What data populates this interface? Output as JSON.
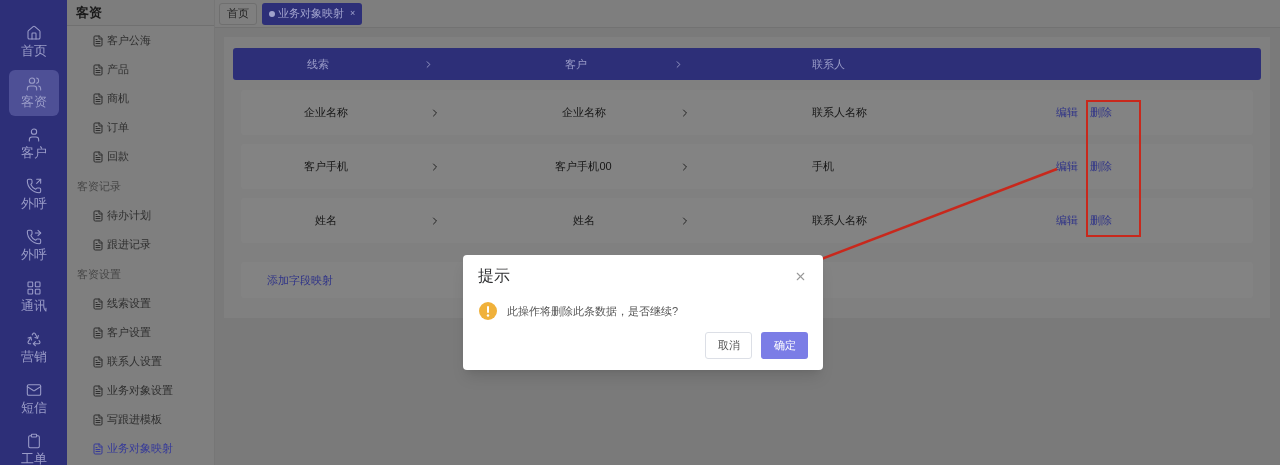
{
  "icon_bar": {
    "items": [
      {
        "label": "首页",
        "selected": false
      },
      {
        "label": "客资",
        "selected": true
      },
      {
        "label": "客户",
        "selected": false
      },
      {
        "label": "外呼",
        "selected": false
      },
      {
        "label": "外呼",
        "selected": false
      },
      {
        "label": "通讯",
        "selected": false
      },
      {
        "label": "营销",
        "selected": false
      },
      {
        "label": "短信",
        "selected": false
      },
      {
        "label": "工单",
        "selected": false
      }
    ]
  },
  "nav": {
    "title": "客资",
    "entries": [
      {
        "kind": "item",
        "label": "客户公海",
        "selected": false
      },
      {
        "kind": "item",
        "label": "产品",
        "selected": false
      },
      {
        "kind": "item",
        "label": "商机",
        "selected": false
      },
      {
        "kind": "item",
        "label": "订单",
        "selected": false
      },
      {
        "kind": "item",
        "label": "回款",
        "selected": false
      },
      {
        "kind": "section",
        "label": "客资记录"
      },
      {
        "kind": "item",
        "label": "待办计划",
        "selected": false
      },
      {
        "kind": "item",
        "label": "跟进记录",
        "selected": false
      },
      {
        "kind": "section",
        "label": "客资设置"
      },
      {
        "kind": "item",
        "label": "线索设置",
        "selected": false
      },
      {
        "kind": "item",
        "label": "客户设置",
        "selected": false
      },
      {
        "kind": "item",
        "label": "联系人设置",
        "selected": false
      },
      {
        "kind": "item",
        "label": "业务对象设置",
        "selected": false
      },
      {
        "kind": "item",
        "label": "写跟进模板",
        "selected": false
      },
      {
        "kind": "item",
        "label": "业务对象映射",
        "selected": true
      }
    ]
  },
  "tabs": [
    {
      "label": "首页",
      "selected": false
    },
    {
      "label": "业务对象映射",
      "selected": true,
      "close": "×"
    }
  ],
  "mapping": {
    "columns": [
      "线索",
      "客户",
      "联系人"
    ],
    "rows": [
      {
        "source": "企业名称",
        "customer": "企业名称",
        "contact": "联系人名称",
        "actions": [
          "编辑",
          "删除"
        ]
      },
      {
        "source": "客户手机",
        "customer": "客户手机00",
        "contact": "手机",
        "actions": [
          "编辑",
          "删除"
        ]
      },
      {
        "source": "姓名",
        "customer": "姓名",
        "contact": "联系人名称",
        "actions": [
          "编辑",
          "删除"
        ]
      }
    ],
    "add_link": "添加字段映射"
  },
  "dialog": {
    "title": "提示",
    "message": "此操作将删除此条数据，是否继续?",
    "buttons": [
      {
        "label": "取消",
        "kind": "default"
      },
      {
        "label": "确定",
        "kind": "primary"
      }
    ]
  }
}
